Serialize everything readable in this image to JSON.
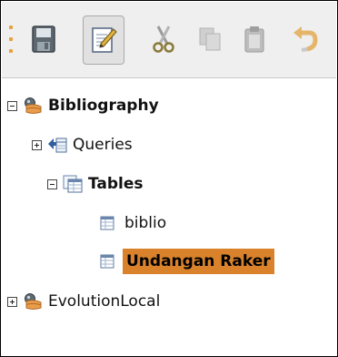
{
  "toolbar": {
    "buttons": [
      {
        "name": "save",
        "icon": "save-icon"
      },
      {
        "name": "edit",
        "icon": "edit-icon",
        "pressed": true
      },
      {
        "name": "cut",
        "icon": "cut-icon",
        "disabled": true
      },
      {
        "name": "copy",
        "icon": "copy-icon",
        "disabled": true
      },
      {
        "name": "paste",
        "icon": "paste-icon",
        "disabled": true
      },
      {
        "name": "undo",
        "icon": "undo-icon",
        "disabled": true
      }
    ]
  },
  "tree": {
    "root": {
      "label": "Bibliography",
      "expanded": true,
      "icon": "database-icon"
    },
    "queries": {
      "label": "Queries",
      "expanded": false,
      "icon": "queries-icon"
    },
    "tables": {
      "label": "Tables",
      "expanded": true,
      "icon": "tables-icon"
    },
    "table_items": [
      {
        "label": "biblio",
        "icon": "table-icon",
        "selected": false
      },
      {
        "label": "Undangan Raker",
        "icon": "table-icon",
        "selected": true
      }
    ],
    "evolution": {
      "label": "EvolutionLocal",
      "expanded": false,
      "icon": "database-icon"
    }
  },
  "colors": {
    "selection": "#d9822b",
    "toolbar_bg": "#efefef",
    "grip": "#e7a23a"
  }
}
